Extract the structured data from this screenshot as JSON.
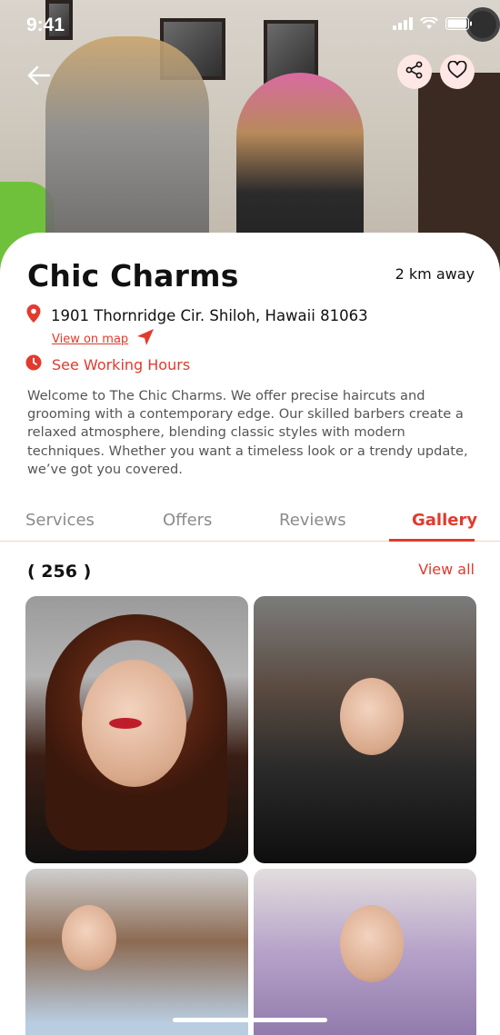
{
  "status_bar": {
    "time": "9:41"
  },
  "salon": {
    "name": "Chic Charms",
    "distance": "2 km away",
    "address": "1901 Thornridge Cir. Shiloh, Hawaii 81063",
    "view_on_map": "View on map",
    "working_hours_label": "See Working Hours",
    "description": "Welcome to The Chic Charms. We offer precise haircuts and grooming with a contemporary edge. Our skilled barbers create a relaxed atmosphere, blending classic styles with modern techniques. Whether you want a timeless look or a trendy update, we’ve got you covered."
  },
  "tabs": [
    {
      "label": "Services",
      "active": false
    },
    {
      "label": "Offers",
      "active": false
    },
    {
      "label": "Reviews",
      "active": false
    },
    {
      "label": "Gallery",
      "active": true
    }
  ],
  "gallery": {
    "count": "( 256 )",
    "view_all": "View all"
  },
  "colors": {
    "accent": "#e23a2d",
    "accent_soft": "#ffe7e5"
  },
  "icons": [
    "back-arrow-icon",
    "share-icon",
    "heart-icon",
    "location-pin-icon",
    "navigation-icon",
    "clock-icon",
    "signal-icon",
    "wifi-icon",
    "battery-icon"
  ]
}
